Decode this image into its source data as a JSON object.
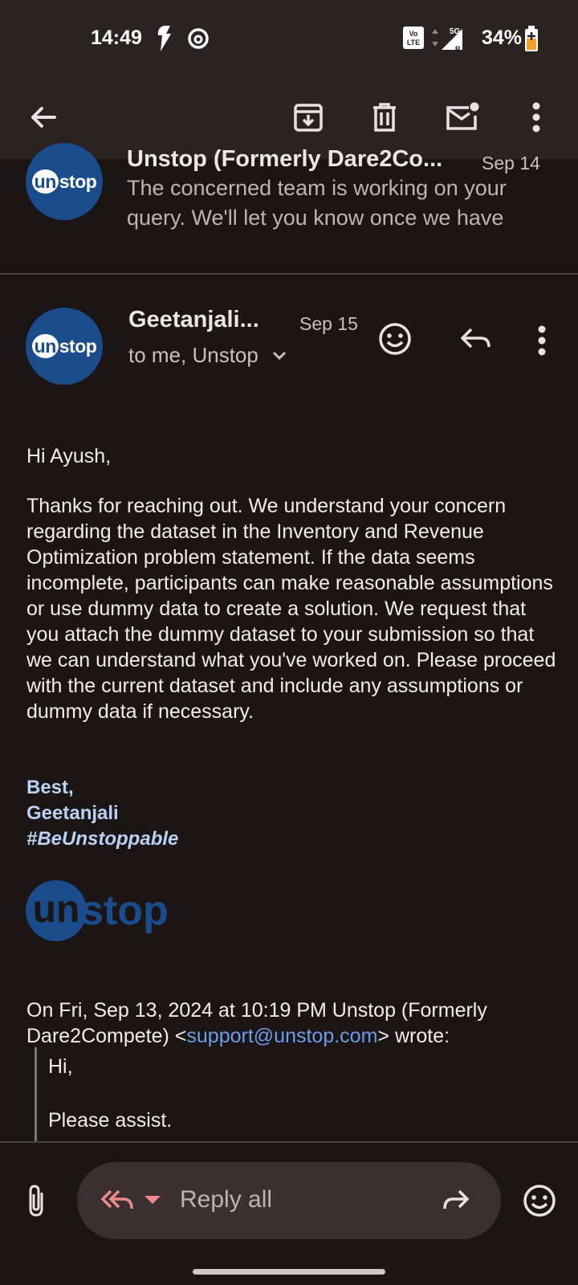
{
  "status": {
    "time": "14:49",
    "signal": "5G",
    "battery": "34%"
  },
  "toolbar": {
    "back_icon": "arrow-left-icon",
    "archive_icon": "archive-icon",
    "delete_icon": "trash-icon",
    "mark_unread_icon": "mail-unread-icon",
    "more_icon": "more-vert-icon"
  },
  "thread": [
    {
      "sender": "Unstop (Formerly Dare2Co...",
      "date": "Sep 14",
      "snippet_line1": "The concerned team is working on your",
      "snippet_line2": "query. We'll let you know once we have",
      "avatar_text_a": "un",
      "avatar_text_b": "stop"
    },
    {
      "sender": "Geetanjali...",
      "date": "Sep 15",
      "recipients": "to me, Unstop",
      "avatar_text_a": "un",
      "avatar_text_b": "stop"
    }
  ],
  "message": {
    "greeting": "Hi Ayush,",
    "body": "Thanks for reaching out. We understand your concern regarding the dataset in the Inventory and Revenue Optimization problem statement. If the data seems incomplete, participants can make reasonable assumptions or use dummy data to create a solution. We request that you attach the dummy dataset to your submission so that we can understand what you've worked on. Please proceed with the current dataset and include any assumptions or dummy data if necessary.",
    "sig_line1": "Best,",
    "sig_line2": "Geetanjali",
    "sig_line3": "#BeUnstoppable",
    "logo_a": "un",
    "logo_b": "stop",
    "quote_header_a": "On Fri, Sep 13, 2024 at 10:19 PM Unstop (Formerly Dare2Compete) <",
    "quote_email": "support@unstop.com",
    "quote_header_b": "> wrote:",
    "quote_line1": "Hi,",
    "quote_line2": "Please assist."
  },
  "reply_bar": {
    "attach_icon": "paperclip-icon",
    "reply_all_icon": "reply-all-icon",
    "label": "Reply all",
    "forward_icon": "forward-icon",
    "emoji_icon": "emoji-icon"
  },
  "colors": {
    "accent_link": "#6b9dea",
    "signature": "#b9d2f2",
    "avatar_bg": "#1a4c8c",
    "reply_icon": "#f08a8a"
  }
}
